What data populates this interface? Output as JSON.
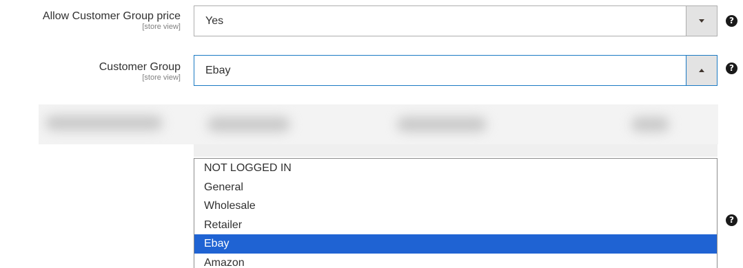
{
  "allow_group_price": {
    "label": "Allow Customer Group price",
    "scope": "[store view]",
    "value": "Yes",
    "help": "?"
  },
  "customer_group": {
    "label": "Customer Group",
    "scope": "[store view]",
    "value": "Ebay",
    "help": "?",
    "options": [
      "NOT LOGGED IN",
      "General",
      "Wholesale",
      "Retailer",
      "Ebay",
      "Amazon"
    ],
    "selected_option": "Ebay"
  },
  "extra_help": "?",
  "colors": {
    "focus_border": "#1979c3",
    "selected_option_bg": "#1f63d3",
    "select_button_bg": "#e3e3e3"
  },
  "icons": {
    "help": "question-circle-icon",
    "closed_select": "chevron-down-icon",
    "open_select": "chevron-up-icon"
  }
}
